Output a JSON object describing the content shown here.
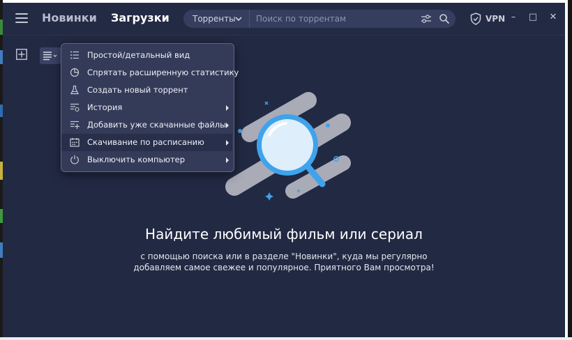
{
  "header": {
    "tabs": [
      {
        "label": "Новинки"
      },
      {
        "label": "Загрузки"
      }
    ],
    "search": {
      "category": "Торренты",
      "placeholder": "Поиск по торрентам"
    },
    "vpn_label": "VPN",
    "window_controls": {
      "minimize": "–",
      "maximize": "□",
      "close": "✕"
    }
  },
  "menu": {
    "items": [
      {
        "label": "Простой/детальный вид",
        "icon": "list-view-icon",
        "submenu": false
      },
      {
        "label": "Спрятать расширенную статистику",
        "icon": "pie-chart-icon",
        "submenu": false
      },
      {
        "label": "Создать новый торрент",
        "icon": "flask-icon",
        "submenu": false
      },
      {
        "label": "История",
        "icon": "history-icon",
        "submenu": true
      },
      {
        "label": "Добавить уже скачанные файлы",
        "icon": "add-files-icon",
        "submenu": true
      },
      {
        "label": "Скачивание по расписанию",
        "icon": "calendar-icon",
        "submenu": true,
        "highlighted": true
      },
      {
        "label": "Выключить компьютер",
        "icon": "power-icon",
        "submenu": true
      }
    ]
  },
  "empty_state": {
    "title": "Найдите любимый фильм или сериал",
    "line1": "с помощью поиска или в разделе \"Новинки\", куда мы регулярно",
    "line2": "добавляем самое свежее и популярное. Приятного Вам просмотра!"
  },
  "colors": {
    "background": "#222943",
    "menu_bg": "#343b59",
    "accent": "#3fa3ec"
  }
}
